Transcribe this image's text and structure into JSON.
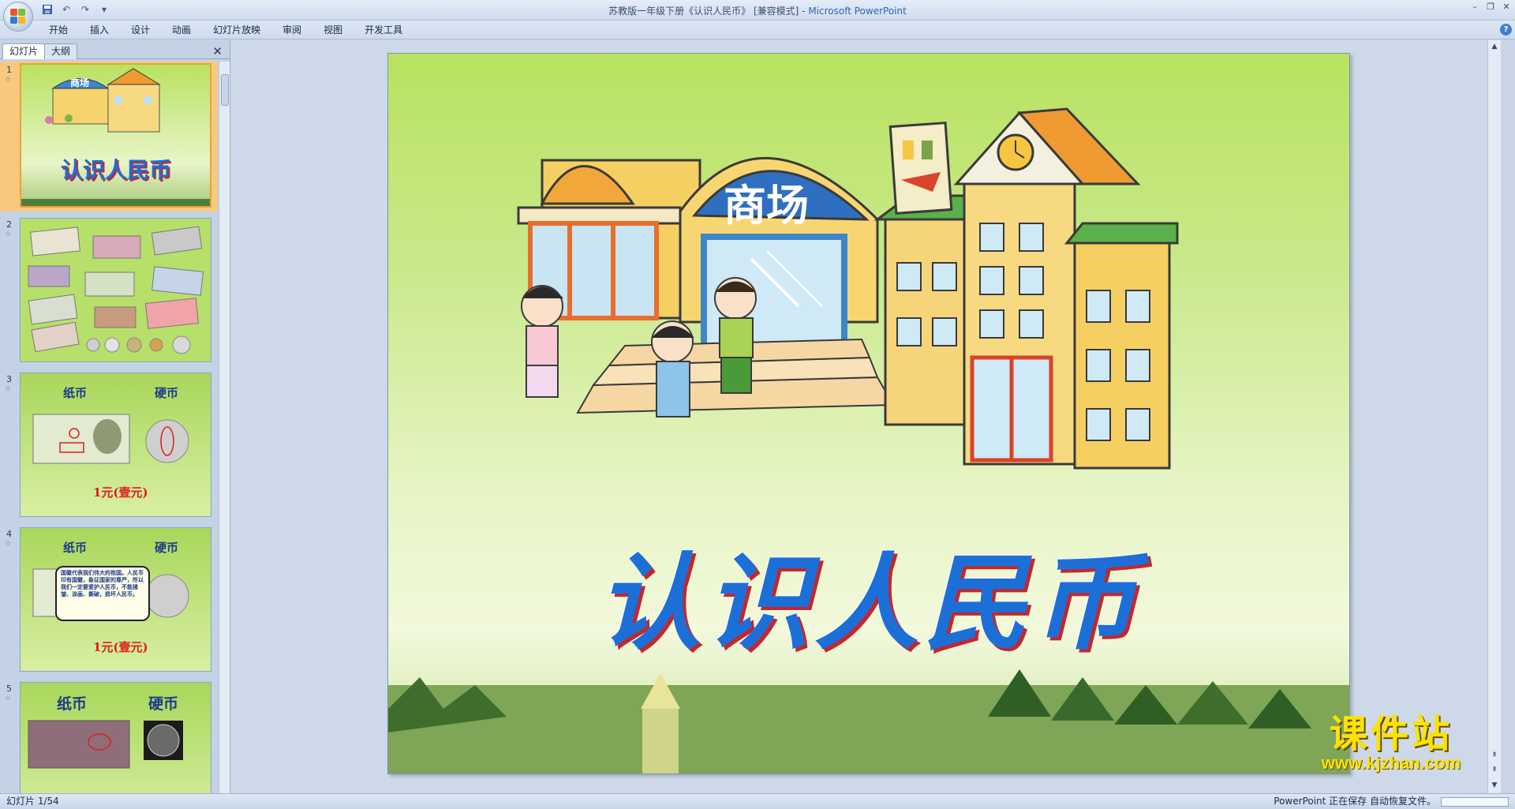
{
  "window": {
    "title_main": "苏教版一年级下册《认识人民币》 [兼容模式] - ",
    "title_brand": "Microsoft PowerPoint"
  },
  "ribbon": {
    "tabs": [
      "开始",
      "插入",
      "设计",
      "动画",
      "幻灯片放映",
      "审阅",
      "视图",
      "开发工具"
    ]
  },
  "pane": {
    "tab_slides": "幻灯片",
    "tab_outline": "大纲",
    "close": "✕"
  },
  "thumbnails": [
    {
      "num": "1",
      "title": "认识人民币",
      "sign": "商场"
    },
    {
      "num": "2"
    },
    {
      "num": "3",
      "left": "纸币",
      "right": "硬币",
      "caption": "1元(壹元)"
    },
    {
      "num": "4",
      "left": "纸币",
      "right": "硬币",
      "bubble": "国徽代表我们伟大的祖国。人民币印有国徽，象征国家的尊严，所以我们一定要爱护人民币，不能揉皱、涂画、撕破，损坏人民币。",
      "caption": "1元(壹元)"
    },
    {
      "num": "5",
      "left": "纸币",
      "right": "硬币"
    }
  ],
  "slide": {
    "sign": "商场",
    "title": "认识人民币"
  },
  "watermark": {
    "top": "课件站",
    "bottom": "www.kjzhan.com"
  },
  "status": {
    "slide_counter": "幻灯片 1/54",
    "saving": "PowerPoint 正在保存 自动恢复文件。"
  },
  "colors": {
    "slide_title": "#1d6fd8",
    "title_shadow": "#c0282e",
    "watermark": "#f9e400",
    "selection": "#f7c97e"
  }
}
